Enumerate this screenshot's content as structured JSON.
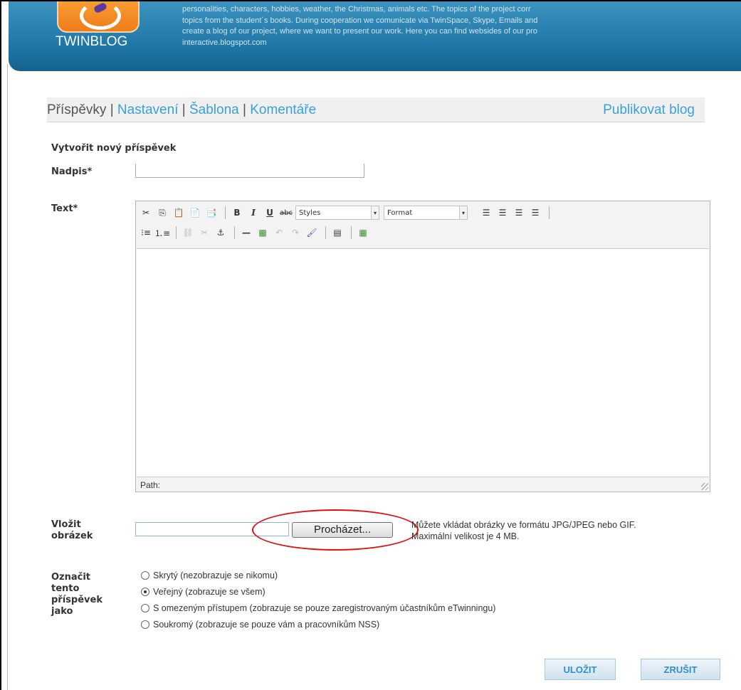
{
  "banner": {
    "brand": "TWINBLOG",
    "description_lines": [
      "personalities, characters, hobbies, weather, the Christmas, animals etc. The topics of the project corr",
      "topics from the student´s books. During cooperation we comunicate via TwinSpace, Skype, Emails and",
      "create a blog of our project, where we want to present our work. Here you can find websides of our pro",
      "interactive.blogspot.com"
    ]
  },
  "nav": {
    "posts": "Příspěvky",
    "settings": "Nastavení",
    "template": "Šablona",
    "comments": "Komentáře",
    "separator": "|",
    "publish": "Publikovat blog"
  },
  "form": {
    "heading": "Vytvořit nový příspěvek",
    "title_label": "Nadpis*",
    "title_value": "",
    "text_label": "Text*",
    "editor": {
      "styles_select": "Styles",
      "format_select": "Format",
      "path_label": "Path:",
      "content": ""
    },
    "image_label_line1": "Vložit",
    "image_label_line2": "obrázek",
    "browse_button": "Procházet...",
    "image_hint_line1": "Můžete vkládat obrázky ve formátu JPG/JPEG nebo GIF.",
    "image_hint_line2": "Maximální  velikost je 4 MB.",
    "mark_label_lines": [
      "Označit",
      "tento",
      "příspěvek",
      "jako"
    ],
    "visibility_options": [
      {
        "label": "Skrytý (nezobrazuje se nikomu)",
        "selected": false
      },
      {
        "label": "Veřejný (zobrazuje se všem)",
        "selected": true
      },
      {
        "label": "S omezeným přístupem (zobrazuje se pouze zaregistrovaným účastníkům eTwinningu)",
        "selected": false
      },
      {
        "label": "Soukromý (zobrazuje se pouze vám a pracovníkům NSS)",
        "selected": false
      }
    ],
    "save_button": "ULOŽIT",
    "cancel_button": "ZRUŠIT"
  },
  "colors": {
    "banner_blue": "#1d74a4",
    "link_blue": "#3aa0d8",
    "annotation_red": "#e01010",
    "logo_orange": "#f07c18"
  }
}
